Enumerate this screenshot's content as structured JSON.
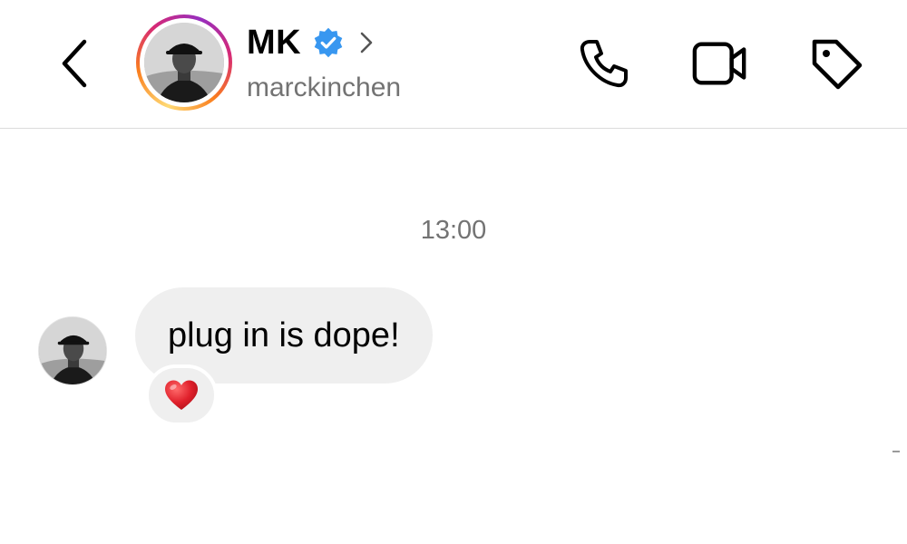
{
  "header": {
    "display_name": "MK",
    "username": "marckinchen",
    "icons": {
      "back": "chevron-left-icon",
      "verified": "verified-badge-icon",
      "profile_chevron": "chevron-right-icon",
      "call": "phone-icon",
      "video": "video-camera-icon",
      "tag": "tag-icon"
    },
    "colors": {
      "verified_badge": "#3897f0",
      "story_ring_start": "#feda75",
      "story_ring_end": "#962fbf"
    }
  },
  "conversation": {
    "timestamp": "13:00",
    "messages": [
      {
        "sender": "marckinchen",
        "text": "plug in is dope!",
        "reaction": "❤️"
      }
    ],
    "colors": {
      "bubble_background": "#efefef",
      "timestamp_text": "#737373"
    }
  }
}
